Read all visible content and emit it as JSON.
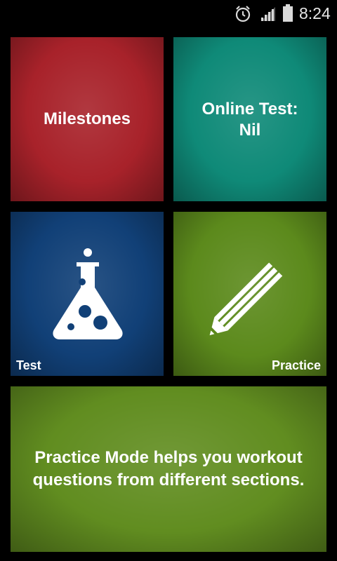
{
  "status_bar": {
    "time": "8:24",
    "icons": [
      "alarm-icon",
      "signal-icon",
      "battery-icon"
    ]
  },
  "tiles": {
    "milestones": {
      "label": "Milestones",
      "color": "#a8222a"
    },
    "online_test": {
      "line1": "Online Test:",
      "line2": "Nil",
      "color": "#0f8a78"
    },
    "test": {
      "label": "Test",
      "icon": "flask-icon",
      "color": "#114077"
    },
    "practice": {
      "label": "Practice",
      "icon": "pencil-icon",
      "color": "#5c8a1c"
    },
    "info": {
      "line1": "Practice Mode helps you workout",
      "line2": "questions from different sections.",
      "color": "#618d20"
    }
  }
}
